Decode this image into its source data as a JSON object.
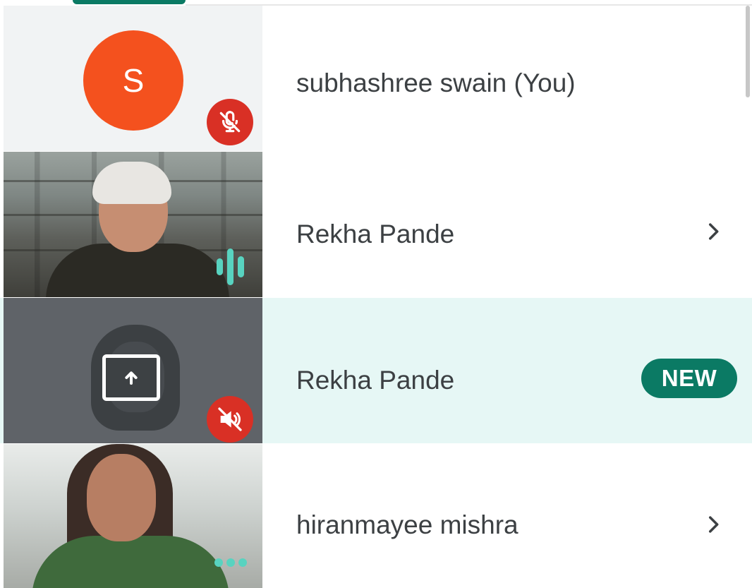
{
  "participants": [
    {
      "name": "subhashree swain (You)",
      "avatar_initial": "S",
      "avatar_color": "#f4511e",
      "status_icon": "mic-off-icon",
      "tile_type": "avatar"
    },
    {
      "name": "Rekha Pande",
      "status_icon": "speaking-icon",
      "tile_type": "video",
      "action_icon": "chevron-right-icon"
    },
    {
      "name": "Rekha Pande",
      "status_icon": "volume-off-icon",
      "tile_type": "presentation",
      "badge": "NEW",
      "highlighted": true
    },
    {
      "name": "hiranmayee mishra",
      "status_icon": "more-icon",
      "tile_type": "video",
      "action_icon": "chevron-right-icon"
    }
  ],
  "colors": {
    "accent": "#0b7a64",
    "highlight_row": "#e6f7f5",
    "muted_badge": "#d93025",
    "speaking": "#58d3c0",
    "text": "#3c4043"
  }
}
